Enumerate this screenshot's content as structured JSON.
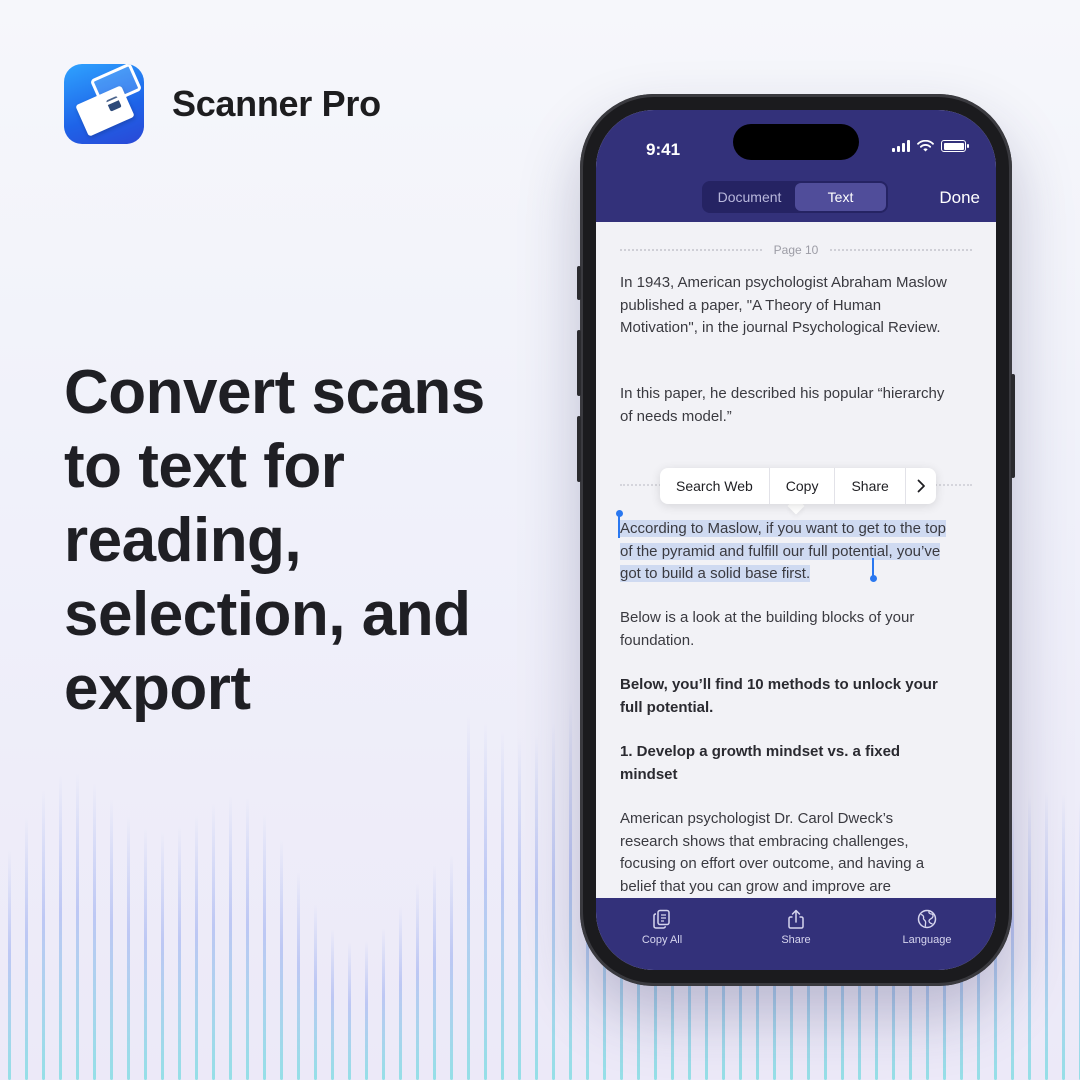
{
  "brand": {
    "name": "Scanner Pro"
  },
  "headline": "Convert scans to text for reading, selection, and export",
  "phone": {
    "status": {
      "time": "9:41"
    },
    "nav": {
      "segments": [
        "Document",
        "Text"
      ],
      "active_segment": "Text",
      "done_label": "Done"
    },
    "page_label": "Page 10",
    "paragraphs": {
      "p1": "In 1943, American psychologist Abraham Maslow published a paper, \"A Theory of Human Motivation\", in the journal Psychological Review.",
      "p2": "In this paper, he described his popular “hierarchy of needs model.”",
      "p3_selected": "According to Maslow, if you want to get to the top of the pyramid and fulfill our full potential, you’ve got to build a solid base first.",
      "p4": "Below is a look at the building blocks of your foundation.",
      "p5": "Below, you’ll find 10 methods to unlock your full potential.",
      "p6": "1. Develop a growth mindset vs. a fixed mindset",
      "p7": "American psychologist Dr. Carol Dweck’s research shows that embracing challenges, focusing on effort over outcome, and having a belief that you can grow and improve are"
    },
    "context_menu": {
      "search_web": "Search Web",
      "copy": "Copy",
      "share": "Share",
      "more": "›"
    },
    "toolbar": {
      "copy_all": "Copy All",
      "share": "Share",
      "language": "Language"
    }
  },
  "colors": {
    "nav_bar": "#33317a",
    "selection": "#cfdaf1",
    "selection_handle": "#2a78f0"
  },
  "icons": [
    "scanner-app-icon",
    "signal-icon",
    "wifi-icon",
    "battery-icon",
    "copy-all-icon",
    "share-icon",
    "globe-icon",
    "chevron-right-icon"
  ]
}
